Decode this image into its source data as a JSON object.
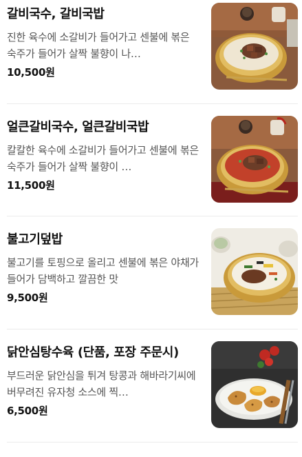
{
  "menu": {
    "items": [
      {
        "name": "갈비국수, 갈비국밥",
        "description": "진한 육수에 소갈비가 들어가고 센불에 볶은 숙주가 들어가 살짝 불향이 나…",
        "price": "10,500원",
        "photo_icon": "noodle-soup-bowl-photo"
      },
      {
        "name": "얼큰갈비국수, 얼큰갈비국밥",
        "description": "칼칼한 육수에 소갈비가 들어가고 센불에 볶은 숙주가 들어가 살짝 불향이 …",
        "price": "11,500원",
        "photo_icon": "spicy-noodle-soup-bowl-photo"
      },
      {
        "name": "불고기덮밥",
        "description": "불고기를 토핑으로 올리고 센불에 볶은 야채가 들어가 담백하고 깔끔한 맛",
        "price": "9,500원",
        "photo_icon": "bulgogi-rice-bowl-photo"
      },
      {
        "name": "닭안심탕수육 (단품, 포장 주문시)",
        "description": "부드러운 닭안심을 튀겨 탕콩과 해바라기씨에 버무려진 유자청 소스에 찍…",
        "price": "6,500원",
        "photo_icon": "fried-chicken-tenders-photo"
      }
    ]
  }
}
